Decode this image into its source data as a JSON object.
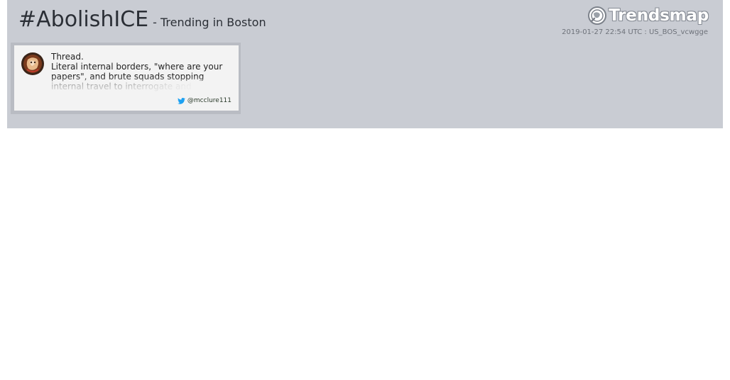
{
  "header": {
    "hashtag": "#AbolishICE",
    "subtitle": "- Trending in Boston",
    "brand": "Trendsmap",
    "meta": "2019-01-27 22:54 UTC : US_BOS_vcwgge"
  },
  "tweet": {
    "lines": [
      "Thread.",
      "Literal internal borders, \"where are your",
      "papers\", and brute squads stopping",
      "internal travel to interrogate and"
    ],
    "handle": "@mcclure111"
  },
  "colors": {
    "banner": "#c9ccd3",
    "card": "#f3f3f3",
    "twitter": "#1da1f2"
  }
}
